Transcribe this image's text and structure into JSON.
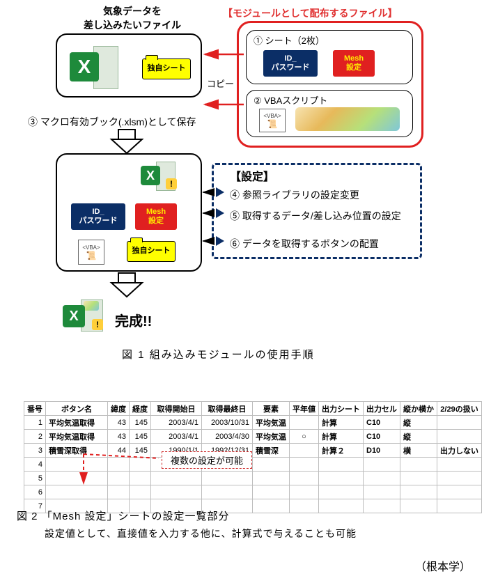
{
  "diagram": {
    "top_left_title_a": "気象データを",
    "top_left_title_b": "差し込みたいファイル",
    "module_box_title": "【モジュールとして配布するファイル】",
    "sheet_group_label": "① シート（2枚）",
    "chip_id_password": "ID_\nパスワード",
    "chip_mesh": "Mesh\n設定",
    "chip_own_sheet": "独自シート",
    "copy_label": "コピー",
    "vba_group_label": "② VBAスクリプト",
    "vba_badge": "<VBA>",
    "step3": "③ マクロ有効ブック(.xlsm)として保存",
    "settings_title": "【設定】",
    "step4": "④ 参照ライブラリの設定変更",
    "step5": "⑤ 取得するデータ/差し込み位置の設定",
    "step6": "⑥ データを取得するボタンの配置",
    "done": "完成!!",
    "fig1_caption": "図 1  組み込みモジュールの使用手順"
  },
  "table": {
    "headers": [
      "番号",
      "ボタン名",
      "緯度",
      "経度",
      "取得開始日",
      "取得最終日",
      "要素",
      "平年値",
      "出力シート",
      "出力セル",
      "縦か横か",
      "2/29の扱い"
    ],
    "rows": [
      {
        "no": "1",
        "btn": "平均気温取得",
        "lat": "43",
        "lon": "145",
        "start": "2003/4/1",
        "end": "2003/10/31",
        "elem": "平均気温",
        "normal": "",
        "sheet": "計算",
        "cell": "C10",
        "orient": "縦",
        "feb29": ""
      },
      {
        "no": "2",
        "btn": "平均気温取得",
        "lat": "43",
        "lon": "145",
        "start": "2003/4/1",
        "end": "2003/4/30",
        "elem": "平均気温",
        "normal": "○",
        "sheet": "計算",
        "cell": "C10",
        "orient": "縦",
        "feb29": ""
      },
      {
        "no": "3",
        "btn": "積雪深取得",
        "lat": "44",
        "lon": "145",
        "start": "1990/1/1",
        "end": "1992/12/31",
        "elem": "積雪深",
        "normal": "",
        "sheet": "計算２",
        "cell": "D10",
        "orient": "横",
        "feb29": "出力しない"
      },
      {
        "no": "4"
      },
      {
        "no": "5"
      },
      {
        "no": "6"
      },
      {
        "no": "7"
      }
    ],
    "note": "複数の設定が可能",
    "fig2_line1": "図 2 「Mesh 設定」シートの設定一覧部分",
    "fig2_line2": "設定値として、直接値を入力する他に、計算式で与えることも可能",
    "author": "（根本学）"
  }
}
